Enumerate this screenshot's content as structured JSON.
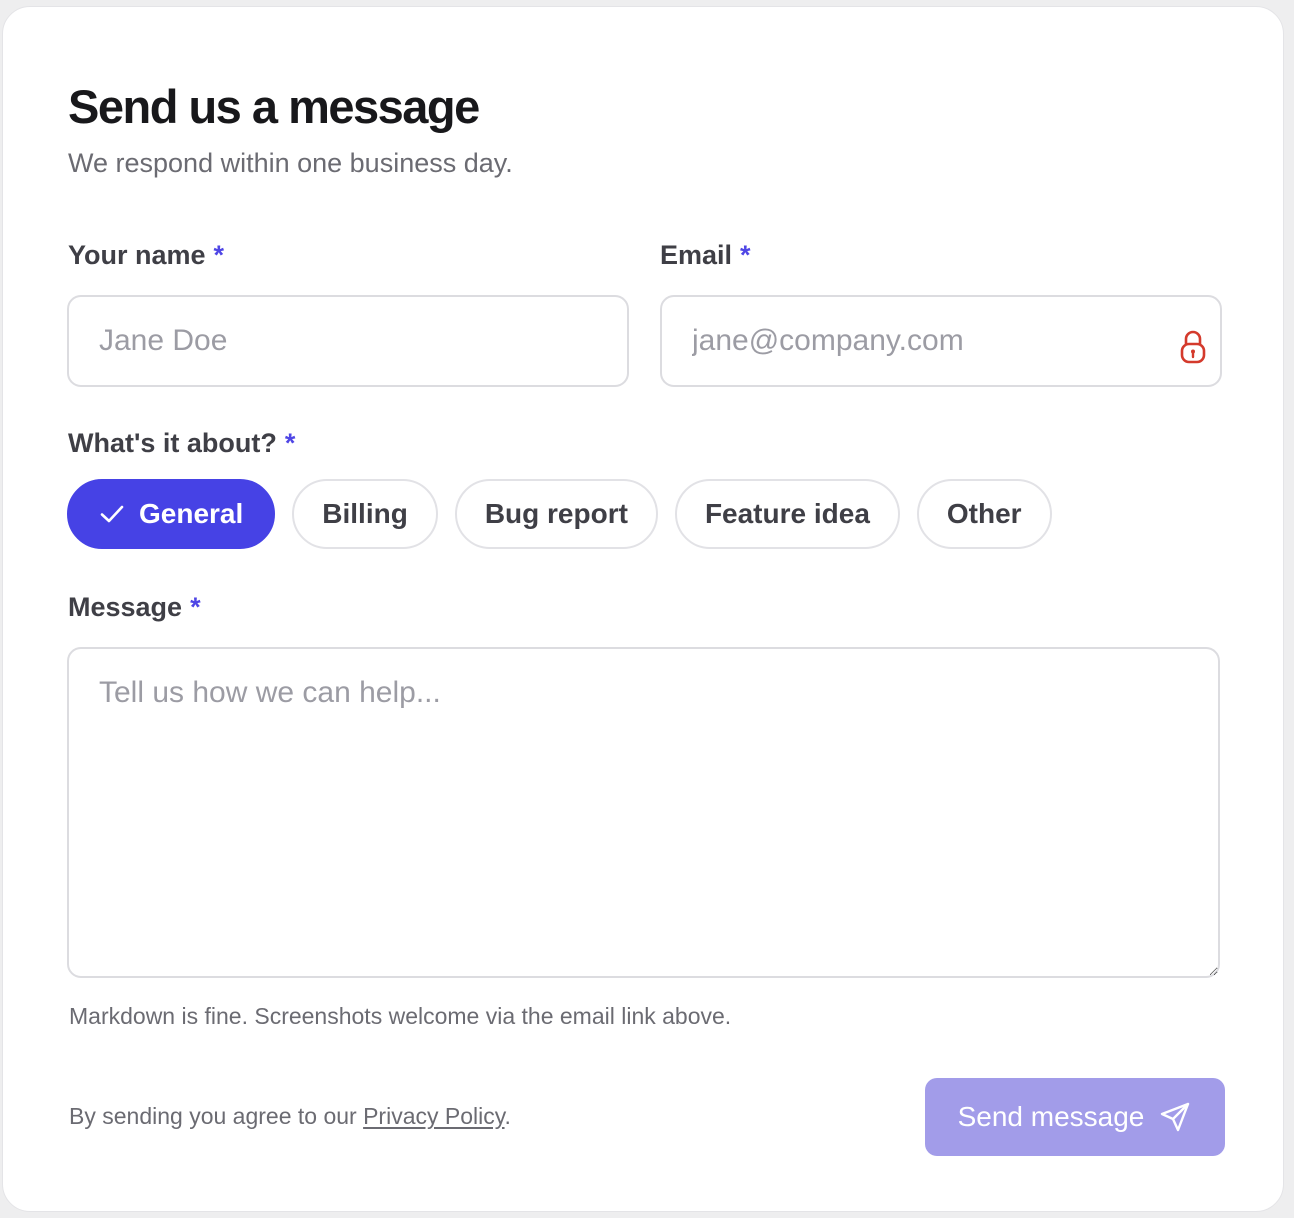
{
  "form": {
    "title": "Send us a message",
    "subtitle": "We respond within one business day.",
    "required_marker": "*",
    "name_label": "Your name",
    "name_placeholder": "Jane Doe",
    "email_label": "Email",
    "email_placeholder": "jane@company.com",
    "topic_label": "What's it about?",
    "topics": [
      {
        "label": "General",
        "selected": true
      },
      {
        "label": "Billing",
        "selected": false
      },
      {
        "label": "Bug report",
        "selected": false
      },
      {
        "label": "Feature idea",
        "selected": false
      },
      {
        "label": "Other",
        "selected": false
      }
    ],
    "message_label": "Message",
    "message_placeholder": "Tell us how we can help...",
    "message_hint": "Markdown is fine. Screenshots welcome via the email link above.",
    "agree_prefix": "By sending you agree to our ",
    "privacy_link": "Privacy Policy",
    "agree_suffix": ".",
    "submit_label": "Send message"
  },
  "icons": {
    "lock": "lock-icon",
    "check": "check-icon",
    "send": "send-icon"
  },
  "colors": {
    "accent": "#4642e5",
    "submit_disabled": "#a29ce9",
    "lock": "#d43a2c",
    "required": "#4f46e5"
  }
}
